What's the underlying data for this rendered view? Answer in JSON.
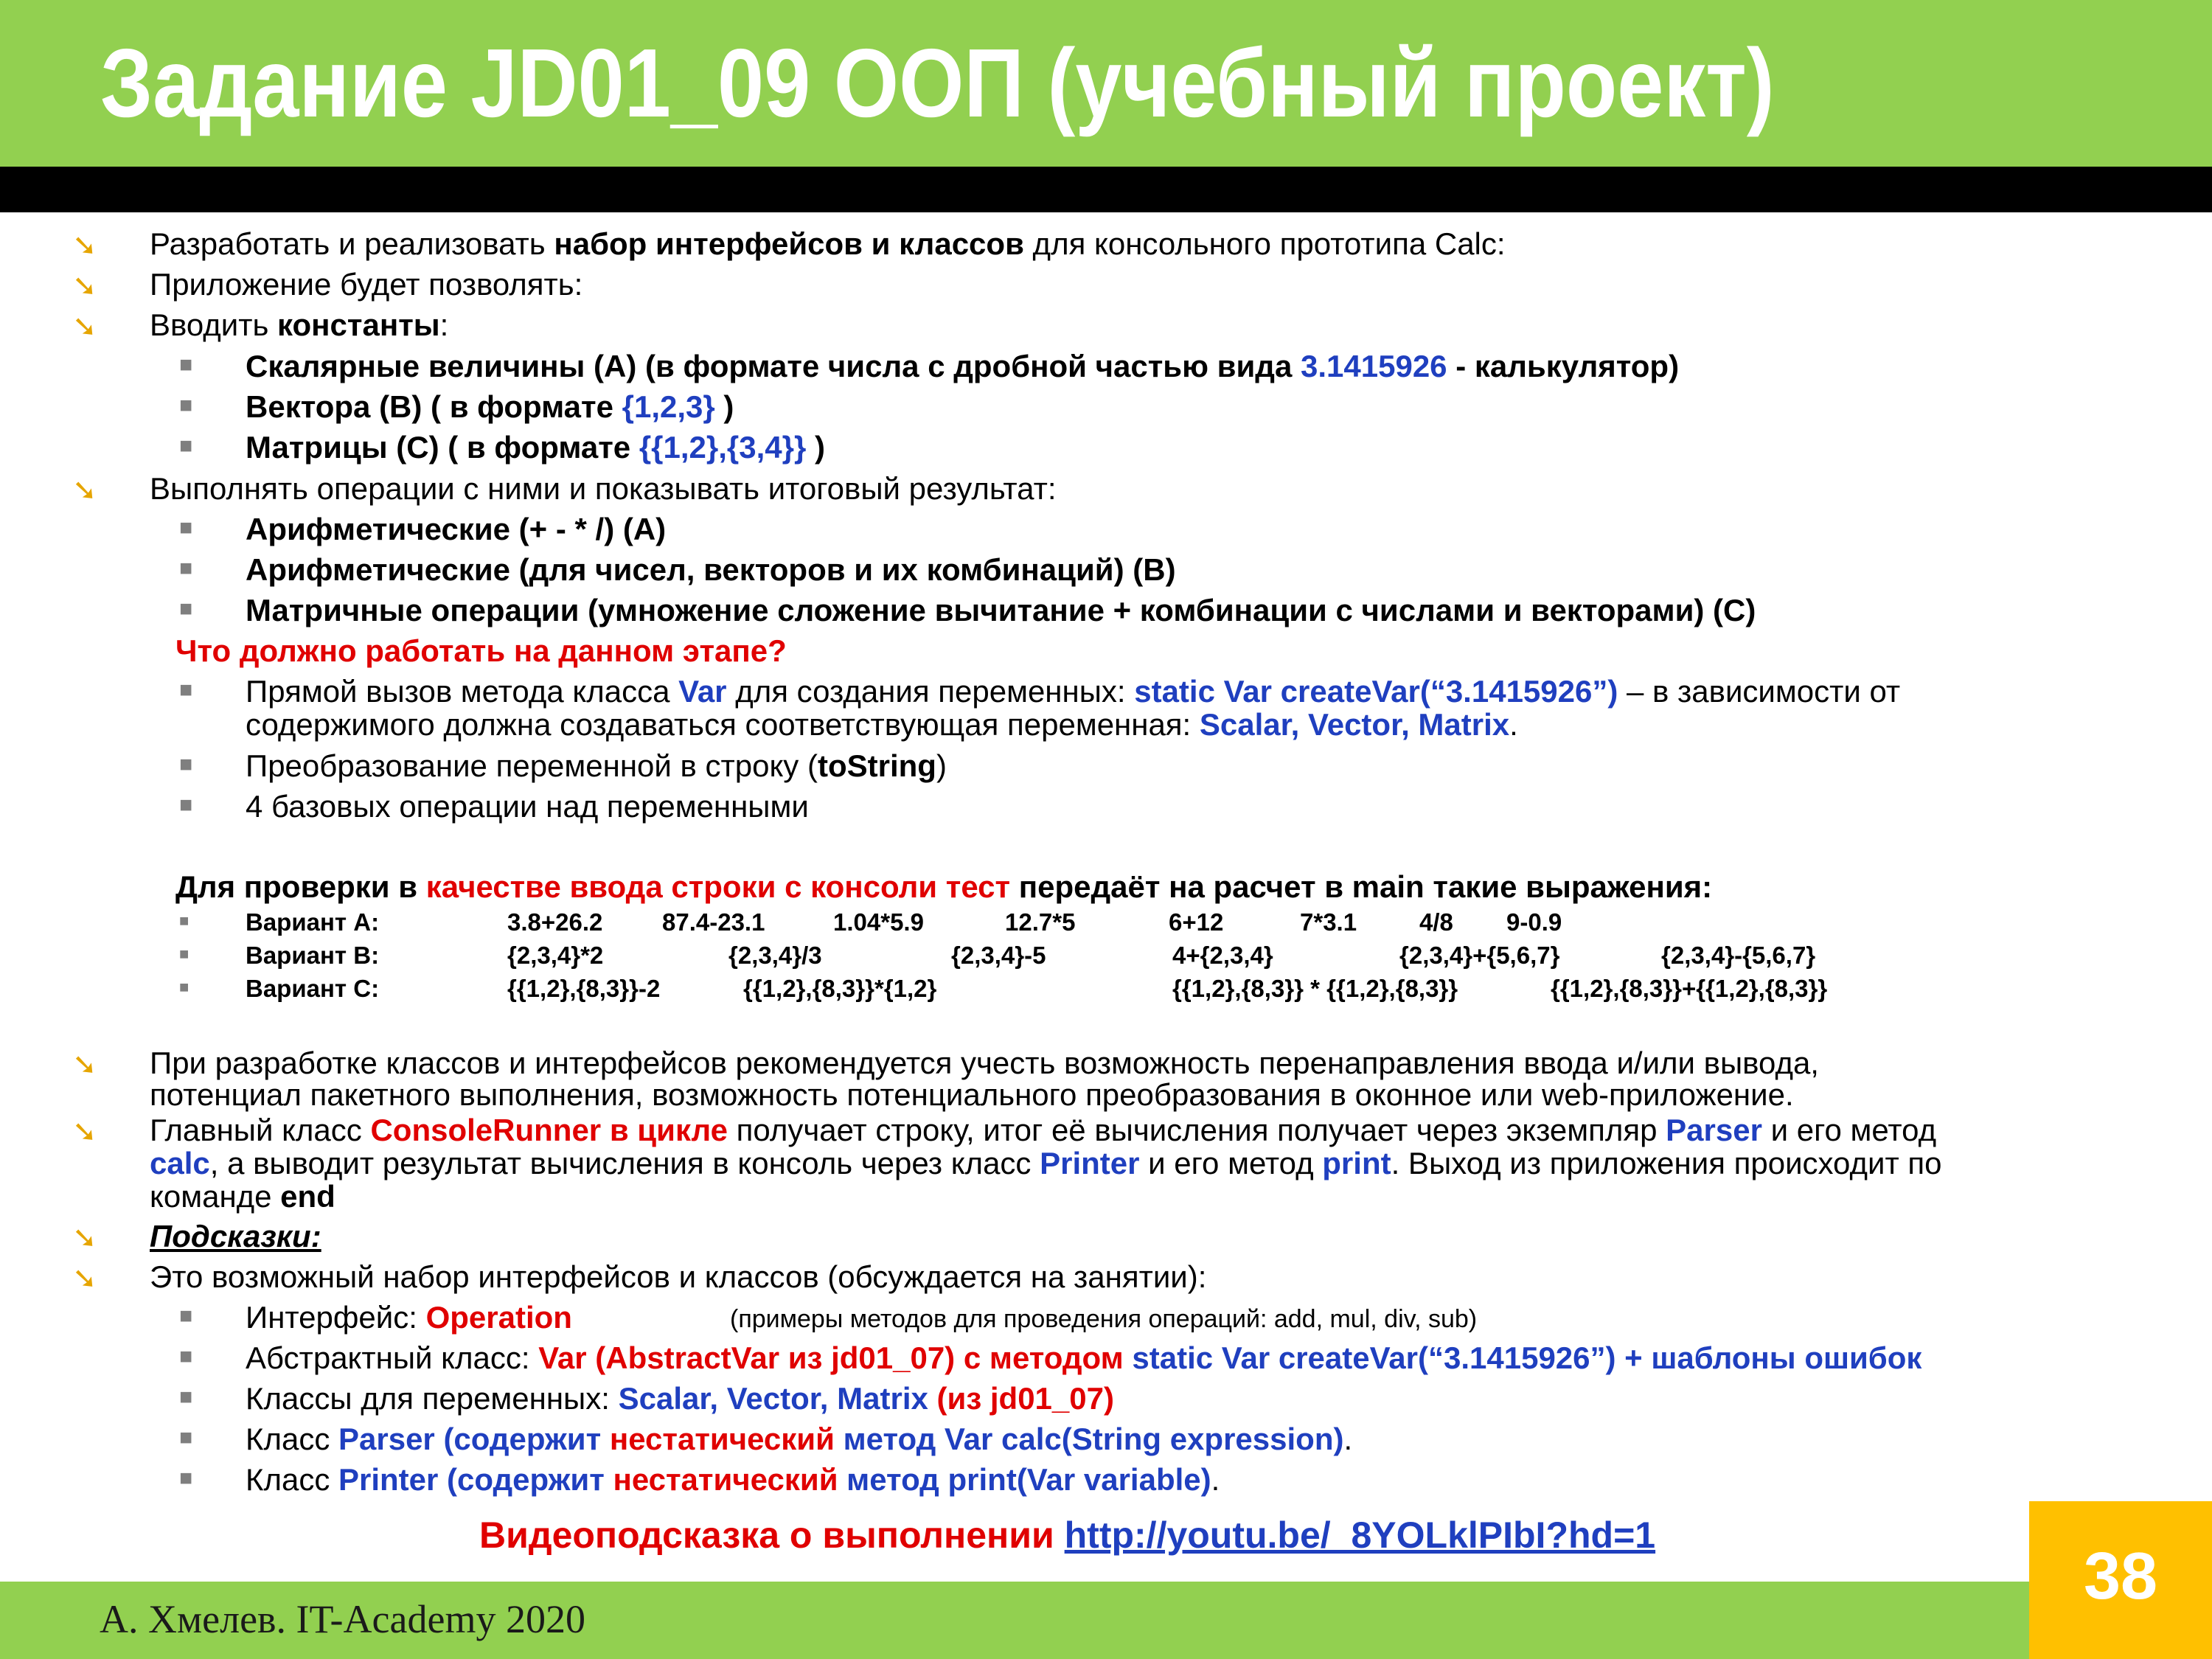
{
  "header": {
    "title": "Задание JD01_09 ООП (учебный проект)"
  },
  "bullets": {
    "b1": {
      "pre": "Разработать и реализовать ",
      "bold": "набор интерфейсов и классов",
      "post": " для консольного прототипа Calc:"
    },
    "b2": "Приложение будет позволять:",
    "b3": {
      "pre": "Вводить ",
      "bold": "константы",
      "post": ":"
    },
    "s1": {
      "bold": "Скалярные величины (A) (в формате числа с дробной частью вида ",
      "blue": "3.1415926",
      "post": " - калькулятор)"
    },
    "s2": {
      "bold": "Вектора (B) (  в формате ",
      "blue": "{1,2,3}",
      "post": "  )"
    },
    "s3": {
      "bold": "Матрицы (C) (  в формате ",
      "blue": "{{1,2},{3,4}}",
      "post": "  )"
    },
    "b4": "Выполнять операции с ними и показывать итоговый результат:",
    "s4": "Арифметические (+ - * /) (A)",
    "s5": "Арифметические (для чисел, векторов и их комбинаций) (B)",
    "s6": "Матричные операции (умножение сложение вычитание + комбинации с числами и векторами) (C)",
    "question": "Что должно работать на данном этапе?",
    "s7": {
      "pre": "Прямой вызов метода класса ",
      "blue1": "Var",
      "mid": " для создания переменных: ",
      "blue2": "static Var createVar(“3.1415926”)",
      "post": " – в зависимости от"
    },
    "s7b": {
      "pre": "содержимого должна создаваться соответствующая переменная: ",
      "blue": "Scalar, Vector, Matrix",
      "post": "."
    },
    "s8": {
      "pre": "Преобразование переменной в строку (",
      "bold": "toString",
      "post": ")"
    },
    "s9": "4 базовых операции над переменными",
    "check": {
      "pre": "Для проверки в ",
      "red": "качестве ввода строки с консоли тест",
      "post": " передаёт на расчет в main такие выражения:"
    }
  },
  "variants": [
    {
      "label": "Вариант A:",
      "items": [
        "3.8+26.2",
        "87.4-23.1",
        "1.04*5.9",
        "12.7*5",
        "6+12",
        "7*3.1",
        "4/8",
        "9-0.9"
      ]
    },
    {
      "label": "Вариант B:",
      "items": [
        "{2,3,4}*2",
        "{2,3,4}/3",
        "{2,3,4}-5",
        "4+{2,3,4}",
        "{2,3,4}+{5,6,7}",
        "{2,3,4}-{5,6,7}"
      ]
    },
    {
      "label": "Вариант C:",
      "items": [
        "{{1,2},{8,3}}-2",
        "{{1,2},{8,3}}*{1,2}",
        "{{1,2},{8,3}} * {{1,2},{8,3}}",
        "{{1,2},{8,3}}+{{1,2},{8,3}}"
      ]
    }
  ],
  "bottom": {
    "b5a": "При разработке классов и интерфейсов рекомендуется учесть возможность перенаправления ввода и/или вывода,",
    "b5b": "потенциал пакетного выполнения, возможность потенциального преобразования в оконное или web-приложение.",
    "b6a": {
      "pre": "Главный класс ",
      "red": "ConsoleRunner в цикле",
      "mid": " получает строку, итог её вычисления получает через экземпляр ",
      "blue": "Parser",
      "post": " и его метод"
    },
    "b6b": {
      "blue1": "calc",
      "mid1": ", а выводит результат вычисления в консоль через класс ",
      "blue2": "Printer",
      "mid2": " и его метод ",
      "blue3": "print",
      "post": ". Выход из приложения происходит по"
    },
    "b6c": {
      "pre": "команде ",
      "bold": "end"
    },
    "hints": "Подсказки:",
    "b7": "Это возможный набор интерфейсов и классов (обсуждается на занятии):",
    "h1": {
      "pre": "Интерфейс: ",
      "red": "Operation",
      "small": "(примеры методов для проведения операций: add, mul, div, sub)"
    },
    "h2": {
      "pre": "Абстрактный класс: ",
      "red": "Var (AbstractVar из jd01_07) с методом ",
      "blue": "static Var createVar(“3.1415926”) + шаблоны ошибок"
    },
    "h3": {
      "pre": "Классы для переменных: ",
      "blue": "Scalar, Vector, Matrix",
      "red": "  (из jd01_07)"
    },
    "h4": {
      "pre": "Класс ",
      "blue1": "Parser (содержит ",
      "red": "нестатический",
      "blue2": " метод Var calc(String expression)",
      "post": "."
    },
    "h5": {
      "pre": "Класс ",
      "blue1": "Printer (содержит ",
      "red": "нестатический",
      "blue2": " метод print(Var variable)",
      "post": "."
    }
  },
  "video": {
    "label": "Видеоподсказка о выполнении ",
    "link": "http://youtu.be/_8YOLklPIbI?hd=1"
  },
  "footer": {
    "author": "А. Хмелев. IT-Academy 2020",
    "page": "38"
  },
  "colors": {
    "green": "#92d050",
    "orange": "#ffc000",
    "blue": "#1f3fbf",
    "red": "#e00000"
  },
  "icons": {
    "main_bullet": "arrow-down-right-icon",
    "sub_bullet": "square-bullet-icon"
  }
}
